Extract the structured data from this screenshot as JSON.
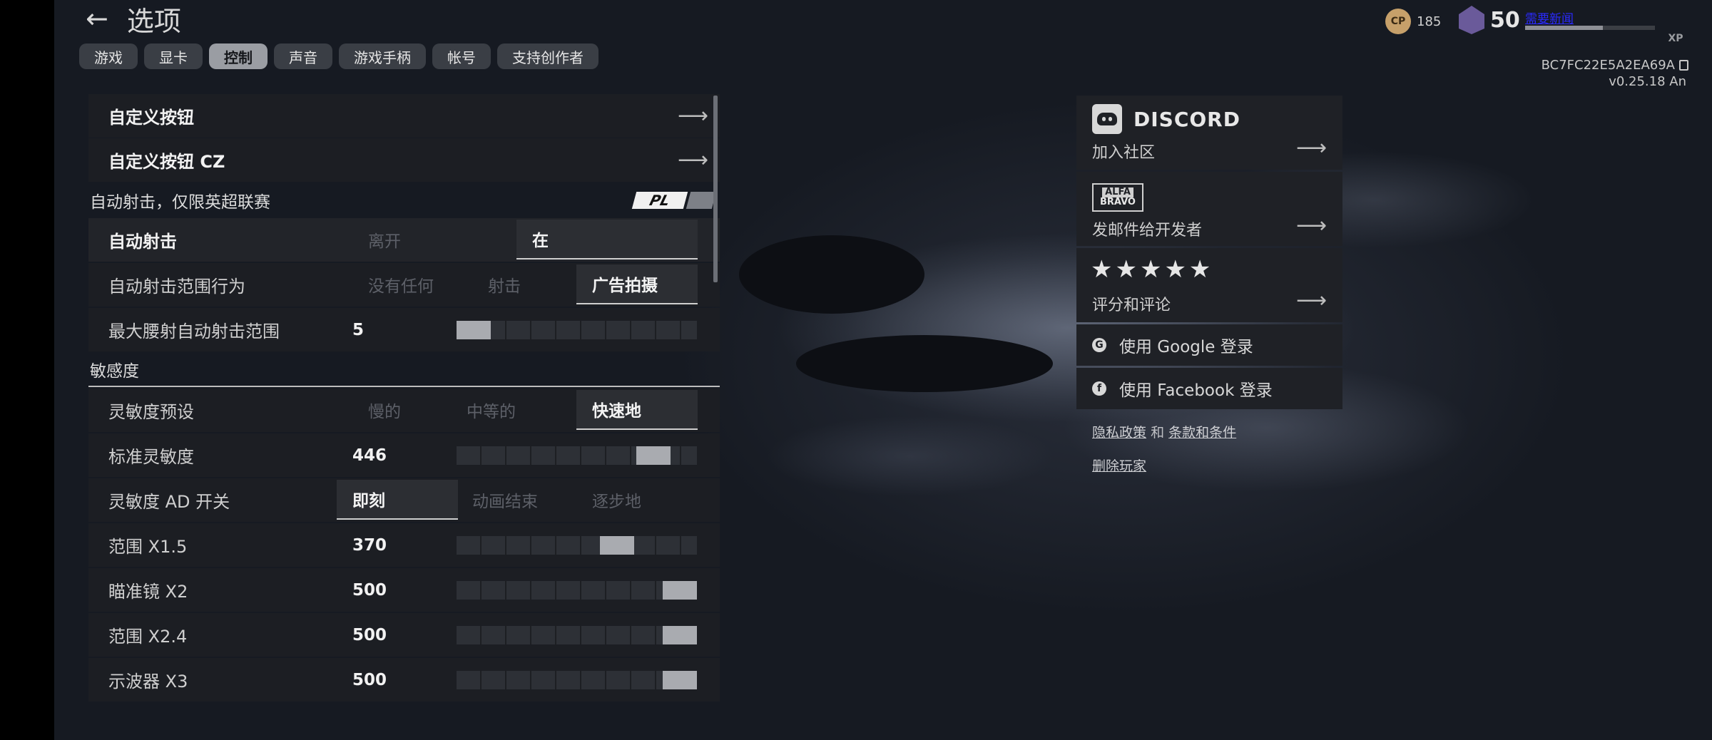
{
  "header": {
    "back_icon": "back-arrow-icon",
    "title": "选项"
  },
  "tabs": [
    {
      "label": "游戏",
      "active": false
    },
    {
      "label": "显卡",
      "active": false
    },
    {
      "label": "控制",
      "active": true
    },
    {
      "label": "声音",
      "active": false
    },
    {
      "label": "游戏手柄",
      "active": false
    },
    {
      "label": "帐号",
      "active": false
    },
    {
      "label": "支持创作者",
      "active": false
    }
  ],
  "settings": {
    "custom_buttons": "自定义按钮",
    "custom_buttons_cz": "自定义按钮 CZ",
    "auto_fire_section": "自动射击，仅限英超联赛",
    "pl_badge": "PL",
    "auto_fire": {
      "label": "自动射击",
      "options": [
        "离开",
        "在"
      ],
      "selected": "在"
    },
    "auto_fire_range_behavior": {
      "label": "自动射击范围行为",
      "options": [
        "没有任何",
        "射击",
        "广告拍摄"
      ],
      "selected": "广告拍摄"
    },
    "max_hipfire_range": {
      "label": "最大腰射自动射击范围",
      "value": "5",
      "fill": 0.12
    },
    "sensitivity_section": "敏感度",
    "sensitivity_preset": {
      "label": "灵敏度预设",
      "options": [
        "慢的",
        "中等的",
        "快速地"
      ],
      "selected": "快速地"
    },
    "standard_sensitivity": {
      "label": "标准灵敏度",
      "value": "446",
      "fill": 0.89
    },
    "ads_toggle": {
      "label": "灵敏度 AD 开关",
      "options": [
        "即刻",
        "动画结束",
        "逐步地"
      ],
      "selected": "即刻"
    },
    "scope_x15": {
      "label": "范围 X1.5",
      "value": "370",
      "fill": 0.74
    },
    "sight_x2": {
      "label": "瞄准镜 X2",
      "value": "500",
      "fill": 1.0
    },
    "scope_x24": {
      "label": "范围 X2.4",
      "value": "500",
      "fill": 1.0
    },
    "scope_x3": {
      "label": "示波器 X3",
      "value": "500",
      "fill": 1.0
    }
  },
  "right_panel": {
    "discord": {
      "brand": "DISCORD",
      "label": "加入社区"
    },
    "alfa": {
      "line1": "ALFA",
      "line2": "BRAVO",
      "label": "发邮件给开发者"
    },
    "rate": {
      "stars": "★★★★★",
      "label": "评分和评论"
    },
    "google_login": "使用 Google 登录",
    "facebook_login": "使用 Facebook 登录",
    "privacy": "隐私政策",
    "and": "和",
    "terms": "条款和条件",
    "delete_player": "删除玩家"
  },
  "top_right": {
    "cp_label": "CP",
    "cp_amount": "185",
    "level": "50",
    "xp_link": "需要新闻",
    "xp_progress": 0.6,
    "xp_label": "XP",
    "player_id": "BC7FC22E5A2EA69A",
    "version": "v0.25.18 An"
  }
}
